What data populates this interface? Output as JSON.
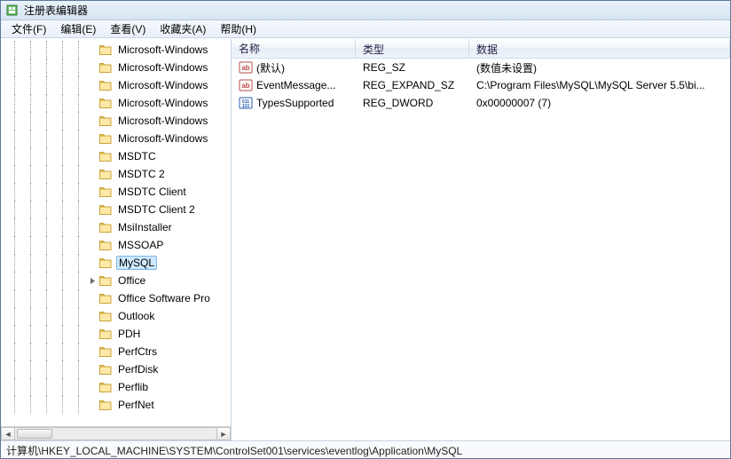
{
  "window": {
    "title": "注册表编辑器"
  },
  "menu": {
    "file": "文件(F)",
    "edit": "编辑(E)",
    "view": "查看(V)",
    "favorites": "收藏夹(A)",
    "help": "帮助(H)"
  },
  "tree": {
    "items": [
      {
        "label": "Microsoft-Windows",
        "selected": false,
        "expander": null
      },
      {
        "label": "Microsoft-Windows",
        "selected": false,
        "expander": null
      },
      {
        "label": "Microsoft-Windows",
        "selected": false,
        "expander": null
      },
      {
        "label": "Microsoft-Windows",
        "selected": false,
        "expander": null
      },
      {
        "label": "Microsoft-Windows",
        "selected": false,
        "expander": null
      },
      {
        "label": "Microsoft-Windows",
        "selected": false,
        "expander": null
      },
      {
        "label": "MSDTC",
        "selected": false,
        "expander": null
      },
      {
        "label": "MSDTC 2",
        "selected": false,
        "expander": null
      },
      {
        "label": "MSDTC Client",
        "selected": false,
        "expander": null
      },
      {
        "label": "MSDTC Client 2",
        "selected": false,
        "expander": null
      },
      {
        "label": "MsiInstaller",
        "selected": false,
        "expander": null
      },
      {
        "label": "MSSOAP",
        "selected": false,
        "expander": null
      },
      {
        "label": "MySQL",
        "selected": true,
        "expander": null
      },
      {
        "label": "Office",
        "selected": false,
        "expander": "collapsed"
      },
      {
        "label": "Office Software Pro",
        "selected": false,
        "expander": null
      },
      {
        "label": "Outlook",
        "selected": false,
        "expander": null
      },
      {
        "label": "PDH",
        "selected": false,
        "expander": null
      },
      {
        "label": "PerfCtrs",
        "selected": false,
        "expander": null
      },
      {
        "label": "PerfDisk",
        "selected": false,
        "expander": null
      },
      {
        "label": "Perflib",
        "selected": false,
        "expander": null
      },
      {
        "label": "PerfNet",
        "selected": false,
        "expander": null
      }
    ]
  },
  "list": {
    "headers": {
      "name": "名称",
      "type": "类型",
      "data": "数据"
    },
    "rows": [
      {
        "icon": "string",
        "name": "(默认)",
        "type": "REG_SZ",
        "data": "(数值未设置)"
      },
      {
        "icon": "string",
        "name": "EventMessage...",
        "type": "REG_EXPAND_SZ",
        "data": "C:\\Program Files\\MySQL\\MySQL Server 5.5\\bi..."
      },
      {
        "icon": "binary",
        "name": "TypesSupported",
        "type": "REG_DWORD",
        "data": "0x00000007 (7)"
      }
    ]
  },
  "status": {
    "path": "计算机\\HKEY_LOCAL_MACHINE\\SYSTEM\\ControlSet001\\services\\eventlog\\Application\\MySQL"
  }
}
